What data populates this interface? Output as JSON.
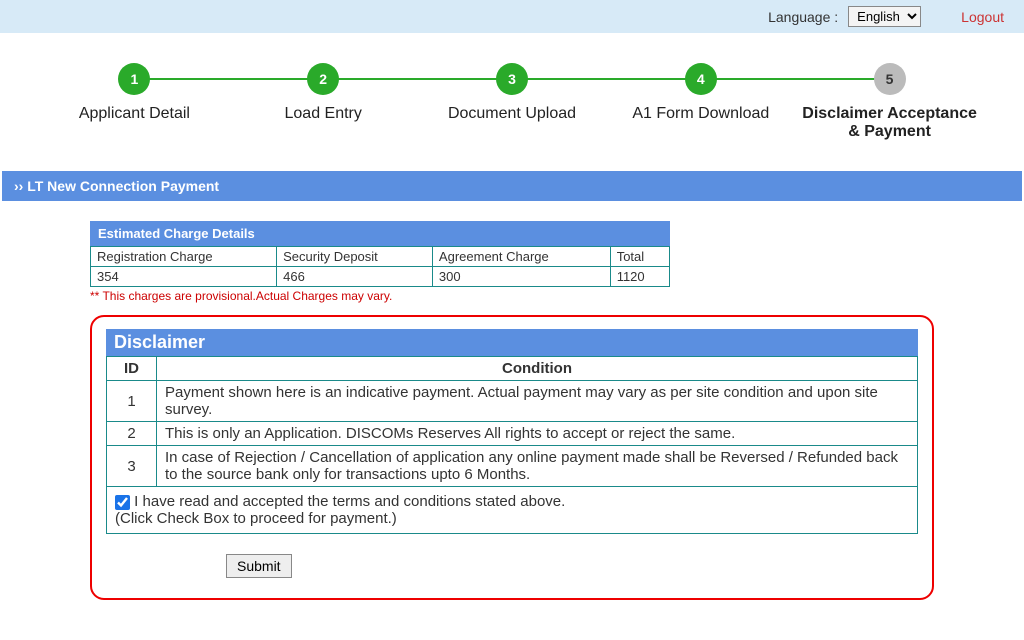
{
  "header": {
    "language_label": "Language :",
    "language_value": "English",
    "logout": "Logout"
  },
  "steps": [
    {
      "num": "1",
      "label": "Applicant Detail",
      "color": "green",
      "bold": false
    },
    {
      "num": "2",
      "label": "Load Entry",
      "color": "green",
      "bold": false
    },
    {
      "num": "3",
      "label": "Document Upload",
      "color": "green",
      "bold": false
    },
    {
      "num": "4",
      "label": "A1 Form Download",
      "color": "green",
      "bold": false
    },
    {
      "num": "5",
      "label": "Disclaimer Acceptance & Payment",
      "color": "grey",
      "bold": true
    }
  ],
  "section_title": "›› LT New Connection Payment",
  "charges": {
    "title": "Estimated Charge Details",
    "headers": [
      "Registration Charge",
      "Security Deposit",
      "Agreement Charge",
      "Total"
    ],
    "values": [
      "354",
      "466",
      "300",
      "1120"
    ],
    "note": "** This charges are provisional.Actual Charges may vary."
  },
  "disclaimer": {
    "title": "Disclaimer",
    "cols": {
      "id": "ID",
      "condition": "Condition"
    },
    "rows": [
      {
        "id": "1",
        "text": "Payment shown here is an indicative payment. Actual payment may vary as per site condition and upon site survey."
      },
      {
        "id": "2",
        "text": "This is only an Application. DISCOMs Reserves All rights to accept or reject the same."
      },
      {
        "id": "3",
        "text": "In case of Rejection / Cancellation of application any online payment made shall be Reversed / Refunded back to the source bank only for transactions upto 6 Months."
      }
    ],
    "accept_text": " I have read and accepted the terms and conditions stated above.",
    "accept_hint": "(Click Check Box to proceed for payment.)",
    "submit": "Submit"
  }
}
